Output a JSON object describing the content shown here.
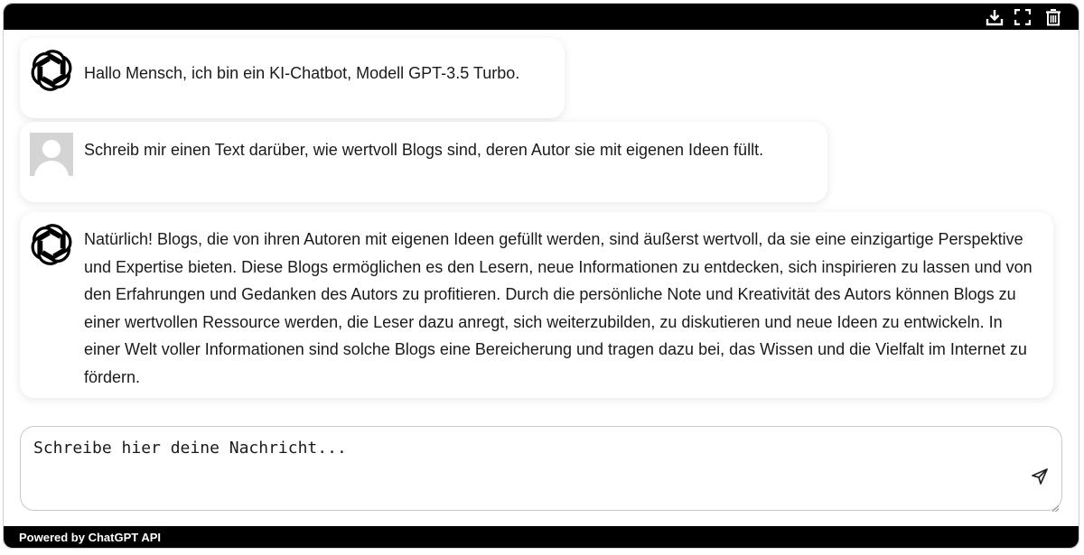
{
  "toolbar": {
    "icons": [
      "download-icon",
      "fullscreen-icon",
      "trash-icon"
    ]
  },
  "messages": [
    {
      "role": "bot",
      "avatar": "openai-logo-icon",
      "text": "Hallo Mensch, ich bin ein KI-Chatbot, Modell GPT-3.5 Turbo."
    },
    {
      "role": "user",
      "avatar": "user-placeholder-icon",
      "text": "Schreib mir einen Text darüber, wie wertvoll Blogs sind, deren Autor sie mit eigenen Ideen füllt."
    },
    {
      "role": "bot",
      "avatar": "openai-logo-icon",
      "text": "Natürlich! Blogs, die von ihren Autoren mit eigenen Ideen gefüllt werden, sind äußerst wertvoll, da sie eine einzigartige Perspektive und Expertise bieten. Diese Blogs ermöglichen es den Lesern, neue Informationen zu entdecken, sich inspirieren zu lassen und von den Erfahrungen und Gedanken des Autors zu profitieren. Durch die persönliche Note und Kreativität des Autors können Blogs zu einer wertvollen Ressource werden, die Leser dazu anregt, sich weiterzubilden, zu diskutieren und neue Ideen zu entwickeln. In einer Welt voller Informationen sind solche Blogs eine Bereicherung und tragen dazu bei, das Wissen und die Vielfalt im Internet zu fördern."
    }
  ],
  "composer": {
    "placeholder": "Schreibe hier deine Nachricht...",
    "send_icon": "send-icon"
  },
  "footer": {
    "powered_by": "Powered by ChatGPT API"
  }
}
